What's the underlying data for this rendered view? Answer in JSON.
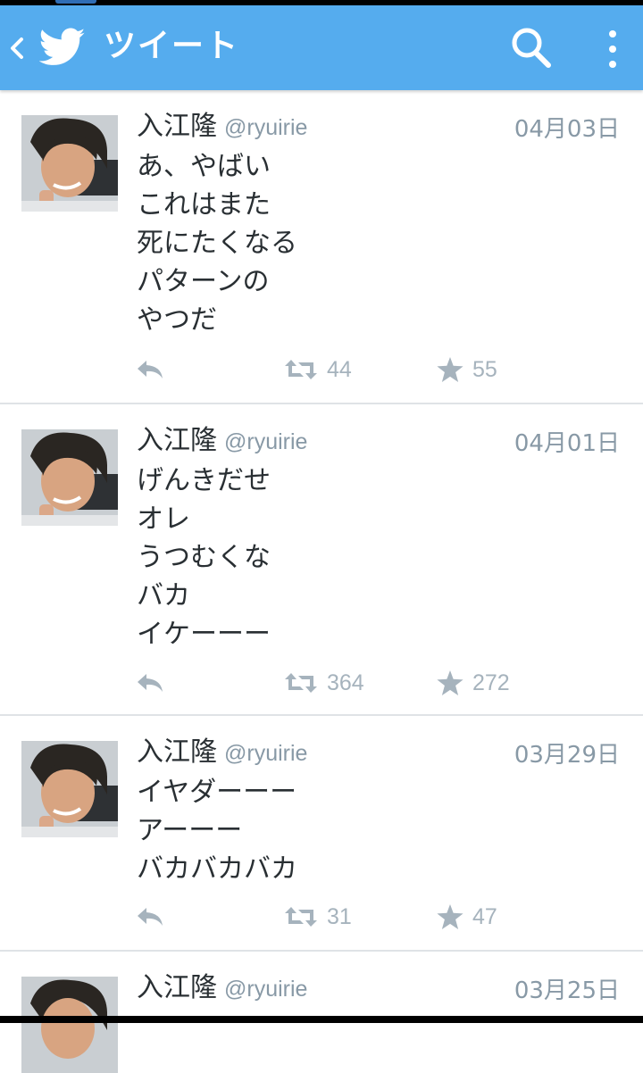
{
  "header": {
    "title": "ツイート",
    "color": "#55acee",
    "icons": [
      "back-chevron-icon",
      "twitter-bird-icon",
      "search-icon",
      "overflow-menu-icon"
    ]
  },
  "tweets": [
    {
      "name": "入江隆",
      "handle": "@ryuirie",
      "date": "04月03日",
      "text": "あ、やばい\nこれはまた\n死にたくなる\nパターンの\nやつだ",
      "retweets": "44",
      "favorites": "55"
    },
    {
      "name": "入江隆",
      "handle": "@ryuirie",
      "date": "04月01日",
      "text": "げんきだせ\nオレ\nうつむくな\nバカ\nイケーーー",
      "retweets": "364",
      "favorites": "272"
    },
    {
      "name": "入江隆",
      "handle": "@ryuirie",
      "date": "03月29日",
      "text": "イヤダーーー\nアーーー\nバカバカバカ",
      "retweets": "31",
      "favorites": "47"
    },
    {
      "name": "入江隆",
      "handle": "@ryuirie",
      "date": "03月25日",
      "text": "",
      "retweets": "",
      "favorites": ""
    }
  ]
}
